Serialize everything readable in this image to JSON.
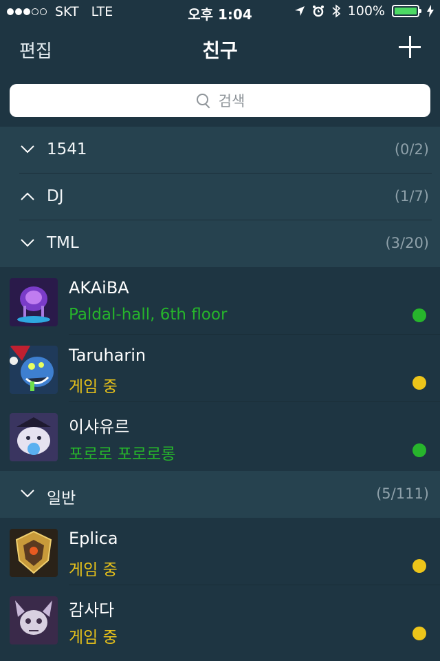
{
  "status_bar": {
    "carrier": "SKT",
    "network": "LTE",
    "time": "오후 1:04",
    "battery": "100%"
  },
  "nav": {
    "edit_label": "편집",
    "title": "친구"
  },
  "search": {
    "placeholder": "검색"
  },
  "groups": [
    {
      "name": "1541",
      "count": "(0/2)",
      "expanded": false
    },
    {
      "name": "DJ",
      "count": "(1/7)",
      "expanded": true
    },
    {
      "name": "TML",
      "count": "(3/20)",
      "expanded": false
    },
    {
      "name": "일반",
      "count": "(5/111)",
      "expanded": false
    }
  ],
  "friends_tml": [
    {
      "name": "AKAiBA",
      "status": "Paldal-hall, 6th floor",
      "state": "online",
      "icon": "purple-jellyfish-icon"
    },
    {
      "name": "Taruharin",
      "status": "게임 중",
      "state": "ingame",
      "icon": "blue-monster-icon"
    },
    {
      "name": "이샤유르",
      "status": "포로로 포로로롱",
      "state": "online",
      "icon": "poro-icon"
    }
  ],
  "friends_general": [
    {
      "name": "Eplica",
      "status": "게임 중",
      "state": "ingame",
      "icon": "golden-shield-icon"
    },
    {
      "name": "감사다",
      "status": "게임 중",
      "state": "ingame",
      "icon": "skull-icon"
    }
  ],
  "colors": {
    "online": "#27b52c",
    "ingame": "#edc51a",
    "background": "#1e3542",
    "group_background": "#26424f"
  }
}
